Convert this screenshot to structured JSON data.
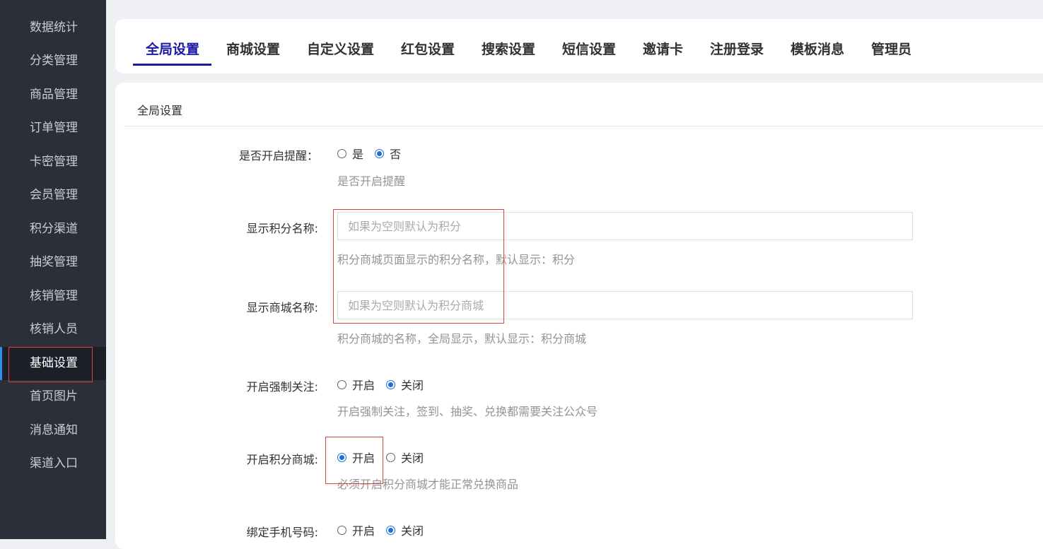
{
  "sidebar": {
    "items": [
      {
        "label": "数据统计"
      },
      {
        "label": "分类管理"
      },
      {
        "label": "商品管理"
      },
      {
        "label": "订单管理"
      },
      {
        "label": "卡密管理"
      },
      {
        "label": "会员管理"
      },
      {
        "label": "积分渠道"
      },
      {
        "label": "抽奖管理"
      },
      {
        "label": "核销管理"
      },
      {
        "label": "核销人员"
      },
      {
        "label": "基础设置"
      },
      {
        "label": "首页图片"
      },
      {
        "label": "消息通知"
      },
      {
        "label": "渠道入口"
      }
    ],
    "active_index": 10
  },
  "tabs": [
    {
      "label": "全局设置"
    },
    {
      "label": "商城设置"
    },
    {
      "label": "自定义设置"
    },
    {
      "label": "红包设置"
    },
    {
      "label": "搜索设置"
    },
    {
      "label": "短信设置"
    },
    {
      "label": "邀请卡"
    },
    {
      "label": "注册登录"
    },
    {
      "label": "模板消息"
    },
    {
      "label": "管理员"
    }
  ],
  "section_title": "全局设置",
  "form": {
    "reminder": {
      "label": "是否开启提醒：",
      "options": [
        "是",
        "否"
      ],
      "selected": "否",
      "hint": "是否开启提醒"
    },
    "points_name": {
      "label": "显示积分名称:",
      "value": "",
      "placeholder": "如果为空则默认为积分",
      "hint": "积分商城页面显示的积分名称，默认显示：积分"
    },
    "mall_name": {
      "label": "显示商城名称:",
      "value": "",
      "placeholder": "如果为空则默认为积分商城",
      "hint": "积分商城的名称，全局显示，默认显示：积分商城"
    },
    "force_follow": {
      "label": "开启强制关注:",
      "options": [
        "开启",
        "关闭"
      ],
      "selected": "关闭",
      "hint": "开启强制关注，签到、抽奖、兑换都需要关注公众号"
    },
    "points_mall": {
      "label": "开启积分商城:",
      "options": [
        "开启",
        "关闭"
      ],
      "selected": "开启",
      "hint": "必须开启积分商城才能正常兑换商品"
    },
    "bind_phone": {
      "label": "绑定手机号码:",
      "options": [
        "开启",
        "关闭"
      ],
      "selected": "关闭"
    }
  },
  "colors": {
    "accent": "#1a1aa6",
    "radio": "#1e6fd9",
    "sidebar_bg": "#2b2f3a",
    "highlight": "#e0413a"
  }
}
